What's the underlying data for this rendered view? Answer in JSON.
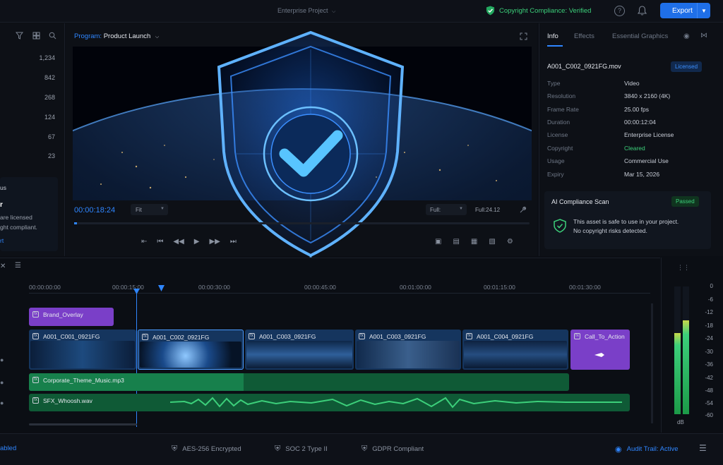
{
  "header": {
    "project": "Enterprise Project",
    "compliance": "Copyright Compliance: Verified",
    "help_icon": "?",
    "export_label": "Export"
  },
  "left_panel": {
    "counts": [
      "1,234",
      "842",
      "268",
      "124",
      "67",
      "23"
    ],
    "promo": {
      "title_fragment": "us",
      "line1": "r",
      "line2": "are licensed",
      "line3": "ght compliant.",
      "link": "rt"
    }
  },
  "monitor": {
    "program_key": "Program:",
    "program_name": "Product Launch",
    "timecode": "00:00:18:24",
    "fit": "Fit",
    "quality_a": "Full:",
    "quality_b": "Full:24.12"
  },
  "inspector": {
    "tabs": [
      "Info",
      "Effects",
      "Essential Graphics"
    ],
    "filename": "A001_C002_0921FG.mov",
    "licensed_badge": "Licensed",
    "fields": [
      {
        "k": "Type",
        "v": "Video"
      },
      {
        "k": "Resolution",
        "v": "3840 x 2160 (4K)"
      },
      {
        "k": "Frame Rate",
        "v": "25.00 fps"
      },
      {
        "k": "Duration",
        "v": "00:00:12:04"
      },
      {
        "k": "License",
        "v": "Enterprise License"
      },
      {
        "k": "Copyright",
        "v": "Cleared"
      },
      {
        "k": "Usage",
        "v": "Commercial Use"
      },
      {
        "k": "Expiry",
        "v": "Mar 15, 2026"
      }
    ],
    "scan_title": "AI Compliance Scan",
    "scan_badge": "Passed",
    "scan_line1": "This asset is safe to use in your project.",
    "scan_line2": "No copyright risks detected."
  },
  "timeline": {
    "timecodes": [
      "00:00:00:00",
      "00:00:15:00",
      "00:00:30:00",
      "00:00:45:00",
      "00:01:00:00",
      "00:01:15:00",
      "00:01:30:00"
    ],
    "overlay_clip": "Brand_Overlay",
    "video_clips": [
      "A001_C001_0921FG",
      "A001_C002_0921FG",
      "A001_C003_0921FG",
      "A001_C003_0921FG",
      "A001_C004_0921FG",
      "Call_To_Action"
    ],
    "music_clip": "Corporate_Theme_Music.mp3",
    "sfx_clip": "SFX_Whoosh.wav"
  },
  "meters": {
    "scale": [
      "0",
      "-6",
      "-12",
      "-18",
      "-24",
      "-30",
      "-36",
      "-42",
      "-48",
      "-54",
      "-60"
    ],
    "unit": "dB"
  },
  "status": {
    "left": "abled",
    "encryption": "AES-256 Encrypted",
    "soc": "SOC 2 Type II",
    "gdpr": "GDPR Compliant",
    "audit": "Audit Trail: Active"
  },
  "colors": {
    "accent": "#1f6fe8",
    "success": "#3ccf7a",
    "overlay_clip": "#7a3fc8",
    "audio_clip": "#17804c"
  }
}
